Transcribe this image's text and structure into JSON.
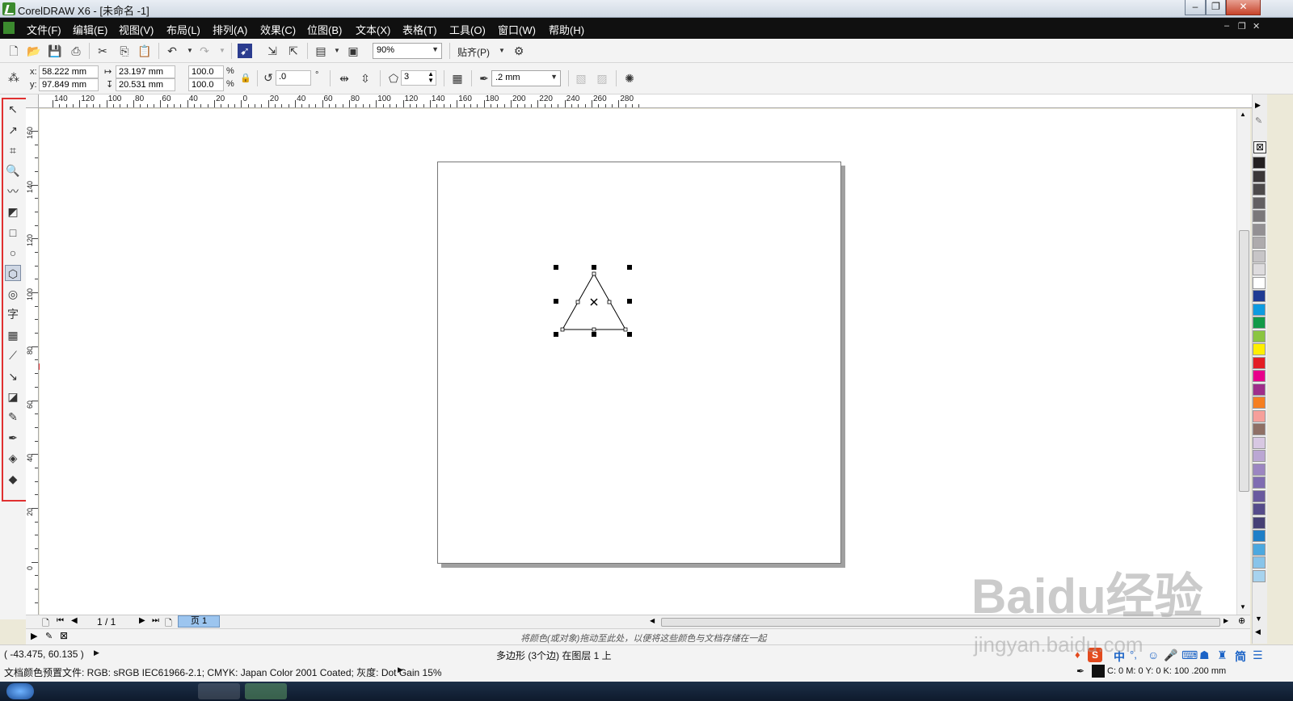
{
  "window": {
    "title": "CorelDRAW X6 - [未命名 -1]",
    "buttons": {
      "minimize": "–",
      "restore": "❐",
      "close": "✕"
    }
  },
  "menu": {
    "items": [
      "文件(F)",
      "编辑(E)",
      "视图(V)",
      "布局(L)",
      "排列(A)",
      "效果(C)",
      "位图(B)",
      "文本(X)",
      "表格(T)",
      "工具(O)",
      "窗口(W)",
      "帮助(H)"
    ]
  },
  "standard_toolbar": {
    "zoom": "90%",
    "snap_label": "贴齐(P)"
  },
  "property_bar": {
    "x_label": "x:",
    "x_value": "58.222 mm",
    "y_label": "y:",
    "y_value": "97.849 mm",
    "width_value": "23.197 mm",
    "height_value": "20.531 mm",
    "scale_x": "100.0",
    "scale_y": "100.0",
    "percent_sign": "%",
    "rotation": ".0",
    "degree_sign": "°",
    "sides": "3",
    "outline_width": ".2 mm"
  },
  "ruler": {
    "top_labels": [
      "140",
      "120",
      "100",
      "80",
      "60",
      "40",
      "20",
      "0",
      "20",
      "40",
      "60",
      "80",
      "100",
      "120",
      "140",
      "160",
      "180",
      "200",
      "220",
      "240",
      "260",
      "280"
    ],
    "left_labels": [
      "160",
      "140",
      "120",
      "100",
      "80",
      "60",
      "40",
      "20",
      "0"
    ]
  },
  "toolbox": {
    "tools": [
      "pick-tool",
      "shape-tool",
      "crop-tool",
      "zoom-tool",
      "freehand-tool",
      "smart-fill-tool",
      "rectangle-tool",
      "ellipse-tool",
      "polygon-tool",
      "basic-shapes-tool",
      "text-tool",
      "table-tool",
      "dimension-tool",
      "connector-tool",
      "blend-tool",
      "eyedropper-tool",
      "outline-tool",
      "fill-tool",
      "interactive-fill-tool"
    ],
    "text_tool_glyph": "字"
  },
  "page_nav": {
    "counter": "1 / 1",
    "tab": "页 1"
  },
  "document_bar": {
    "hint": "将颜色(或对象)拖动至此处，以便将这些颜色与文档存储在一起"
  },
  "status": {
    "coords": "( -43.475, 60.135 )",
    "selection_info": "多边形 (3个边) 在图层 1 上",
    "color_profile": "文档颜色预置文件: RGB: sRGB IEC61966-2.1; CMYK: Japan Color 2001 Coated; 灰度: Dot Gain 15%",
    "fill_info": "C: 0 M: 0 Y: 0 K: 100  .200 mm"
  },
  "palette_colors": [
    "#231f20",
    "#3b3738",
    "#4d4a4b",
    "#636062",
    "#7b787a",
    "#939093",
    "#aeabad",
    "#c7c5c7",
    "#dedcde",
    "#ffffff",
    "#1f3b93",
    "#0d9be0",
    "#139a48",
    "#8bc540",
    "#ffef00",
    "#e31e24",
    "#e8008a",
    "#9f2e8a",
    "#f57f20",
    "#f6a09a",
    "#8f7065",
    "#d8c8e2",
    "#bba7d3",
    "#9c86c1",
    "#7f6cb1",
    "#6a5a9e",
    "#564c8a",
    "#464074",
    "#1e7fc7",
    "#4ba8df",
    "#88c4e9",
    "#a7d3ee"
  ],
  "ime": {
    "chars": [
      "中",
      "简"
    ]
  },
  "watermark": {
    "brand": "Baidu经验",
    "url": "jingyan.baidu.com"
  }
}
